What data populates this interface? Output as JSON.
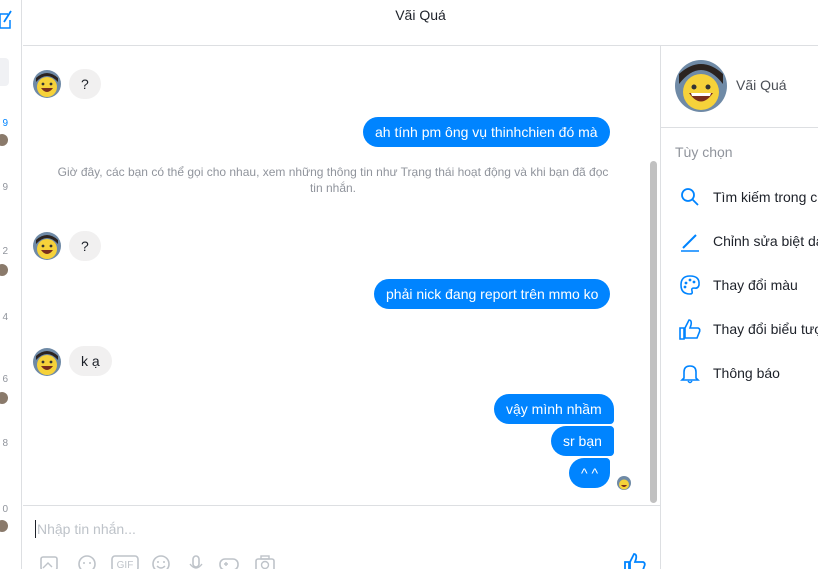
{
  "header": {
    "title": "Vãi Quá"
  },
  "sidebar": {
    "times": [
      "9",
      "9",
      "2",
      "4",
      "6",
      "8",
      "0"
    ]
  },
  "messages": [
    {
      "from": "them",
      "text": "?"
    },
    {
      "from": "me",
      "text": "ah tính pm ông vụ thinhchien đó mà"
    },
    {
      "from": "system",
      "text": "Giờ đây, các bạn có thể gọi cho nhau, xem những thông tin như Trạng thái hoạt động và khi bạn đã đọc tin nhắn."
    },
    {
      "from": "them",
      "text": "?"
    },
    {
      "from": "me",
      "text": "phải nick đang report trên mmo ko"
    },
    {
      "from": "them",
      "text": "k ạ"
    },
    {
      "from": "me",
      "text": "vậy mình nhầm"
    },
    {
      "from": "me",
      "text": "sr bạn"
    },
    {
      "from": "me",
      "text": "^ ^"
    }
  ],
  "composer": {
    "placeholder": "Nhập tin nhắn..."
  },
  "profile": {
    "name": "Vãi Quá"
  },
  "options": {
    "title": "Tùy chọn",
    "items": [
      {
        "icon": "search-icon",
        "label": "Tìm kiếm trong cu"
      },
      {
        "icon": "pencil-icon",
        "label": "Chỉnh sửa biệt da"
      },
      {
        "icon": "palette-icon",
        "label": "Thay đổi màu"
      },
      {
        "icon": "thumbs-up-icon",
        "label": "Thay đổi biểu tượ"
      },
      {
        "icon": "bell-icon",
        "label": "Thông báo"
      }
    ]
  },
  "colors": {
    "accent": "#0084ff",
    "incoming_bubble": "#f1f0f0",
    "muted_text": "#90949c"
  }
}
